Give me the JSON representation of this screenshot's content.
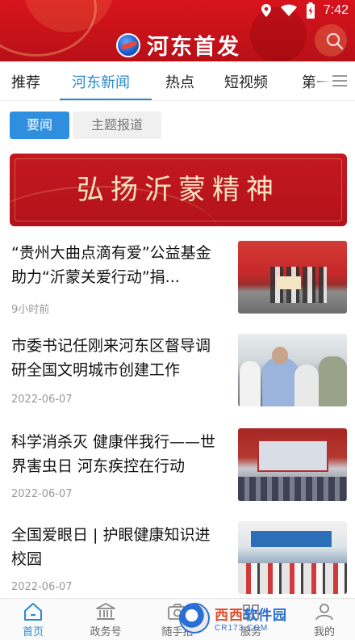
{
  "status_bar": {
    "time": "7:42",
    "icons": [
      "location-icon",
      "wifi-icon",
      "battery-charging-icon"
    ]
  },
  "header": {
    "app_name": "河东首发",
    "logo_icon": "app-logo-icon",
    "search_icon": "search-icon",
    "background_color": "#d7131d"
  },
  "tabs": {
    "items": [
      {
        "label": "推荐",
        "active": false
      },
      {
        "label": "河东新闻",
        "active": true
      },
      {
        "label": "热点",
        "active": false
      },
      {
        "label": "短视频",
        "active": false
      },
      {
        "label": "第一",
        "active": false
      }
    ],
    "active_color": "#2a8ad0",
    "menu_icon": "menu-icon"
  },
  "subtabs": {
    "items": [
      {
        "label": "要闻",
        "active": true
      },
      {
        "label": "主题报道",
        "active": false
      }
    ]
  },
  "banner": {
    "text": "弘扬沂蒙精神"
  },
  "news": [
    {
      "title": "“贵州大曲点滴有爱”公益基金助力“沂蒙关爱行动”捐...",
      "meta": "9小时前"
    },
    {
      "title": "市委书记任刚来河东区督导调研全国文明城市创建工作",
      "meta": "2022-06-07"
    },
    {
      "title": "科学消杀灭 健康伴我行——世界害虫日 河东疾控在行动",
      "meta": "2022-06-07"
    },
    {
      "title": "全国爱眼日 | 护眼健康知识进校园",
      "meta": "2022-06-07"
    }
  ],
  "bottom_nav": {
    "items": [
      {
        "label": "首页",
        "icon": "home-icon",
        "active": true
      },
      {
        "label": "政务号",
        "icon": "government-building-icon",
        "active": false
      },
      {
        "label": "随手拍",
        "icon": "camera-icon",
        "active": false
      },
      {
        "label": "服务",
        "icon": "service-icon",
        "active": false
      },
      {
        "label": "我的",
        "icon": "user-icon",
        "active": false
      }
    ]
  },
  "watermark": {
    "name_part1": "西西",
    "name_part2": "软件园",
    "url": "CR173.COM"
  }
}
